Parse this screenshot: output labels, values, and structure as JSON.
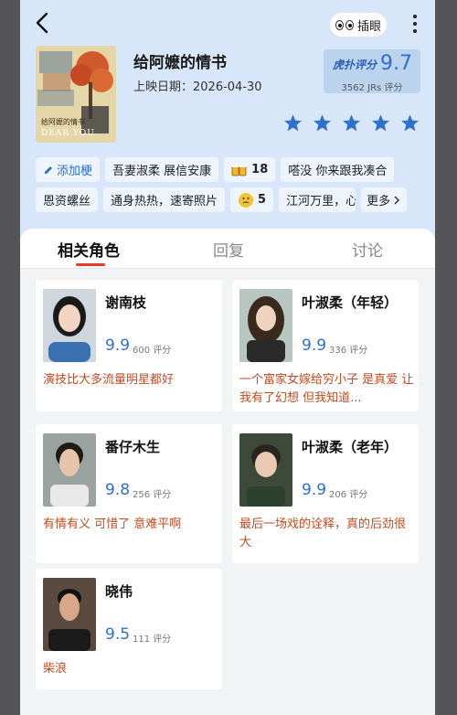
{
  "header": {
    "eye_label": "插眼"
  },
  "movie": {
    "title": "给阿嬷的情书",
    "release": "上映日期：2026-04-30",
    "poster_caption": "DEAR YOU",
    "score_logo": "虎扑评分",
    "score": "9.7",
    "score_count": "3562 JRs 评分",
    "stars": 5,
    "accent": "#2f6fd0"
  },
  "tags": {
    "row1": [
      {
        "label": "添加梗",
        "type": "add"
      },
      {
        "label": "吾妻淑柔 展信安康"
      },
      {
        "label": "18",
        "icon": "cheers-emoji"
      },
      {
        "label": "嗒没 你来跟我凑合"
      }
    ],
    "row2": [
      {
        "label": "恩资螺丝"
      },
      {
        "label": "通身热热，速寄照片"
      },
      {
        "label": "5",
        "icon": "thinking-emoji"
      },
      {
        "label": "江河万里，心"
      },
      {
        "label": "更多"
      }
    ]
  },
  "tabs": [
    {
      "label": "相关角色",
      "active": true
    },
    {
      "label": "回复",
      "active": false
    },
    {
      "label": "讨论",
      "active": false
    }
  ],
  "characters": [
    {
      "name": "谢南枝",
      "score": "9.9",
      "count": "600 评分",
      "quote": "演技比大多流量明星都好"
    },
    {
      "name": "叶淑柔（年轻）",
      "score": "9.9",
      "count": "336 评分",
      "quote": "一个富家女嫁给穷小子 是真爱 让我有了幻想 但我知道..."
    },
    {
      "name": "番仔木生",
      "score": "9.8",
      "count": "256 评分",
      "quote": "有情有义 可惜了 意难平啊"
    },
    {
      "name": "叶淑柔（老年）",
      "score": "9.9",
      "count": "206 评分",
      "quote": "最后一场戏的诠释，真的后劲很大"
    },
    {
      "name": "晓伟",
      "score": "9.5",
      "count": "111 评分",
      "quote": "柴浪"
    }
  ],
  "colors": {
    "page_bg": "#d7e6f8",
    "score_blue": "#2f6fd0",
    "quote_orange": "#c24c22",
    "tab_red": "#e43b2c"
  }
}
